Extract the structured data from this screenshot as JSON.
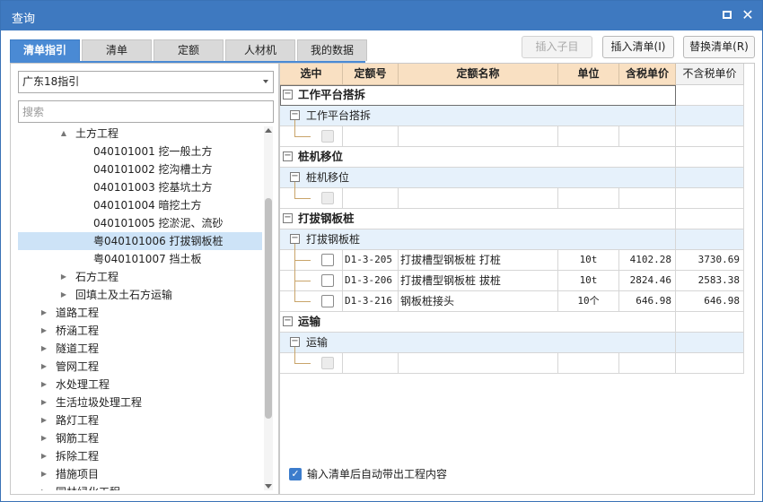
{
  "window": {
    "title": "查询"
  },
  "tabs": [
    {
      "label": "清单指引"
    },
    {
      "label": "清单"
    },
    {
      "label": "定额"
    },
    {
      "label": "人材机"
    },
    {
      "label": "我的数据"
    }
  ],
  "toolbar": {
    "insert_child": "插入子目",
    "insert_list": "插入清单(I)",
    "replace_list": "替换清单(R)"
  },
  "left": {
    "combo_value": "广东18指引",
    "search_placeholder": "搜索",
    "tree": [
      {
        "code": "",
        "name": "土方工程",
        "toggle": "▲"
      },
      {
        "code": "040101001",
        "name": "挖一般土方",
        "toggle": ""
      },
      {
        "code": "040101002",
        "name": "挖沟槽土方",
        "toggle": ""
      },
      {
        "code": "040101003",
        "name": "挖基坑土方",
        "toggle": ""
      },
      {
        "code": "040101004",
        "name": "暗挖土方",
        "toggle": ""
      },
      {
        "code": "040101005",
        "name": "挖淤泥、流砂",
        "toggle": ""
      },
      {
        "code": "粤040101006",
        "name": "打拔钢板桩",
        "toggle": ""
      },
      {
        "code": "粤040101007",
        "name": "挡土板",
        "toggle": ""
      },
      {
        "code": "",
        "name": "石方工程",
        "toggle": "▶"
      },
      {
        "code": "",
        "name": "回填土及土石方运输",
        "toggle": "▶"
      },
      {
        "code": "",
        "name": "道路工程",
        "toggle": "▶"
      },
      {
        "code": "",
        "name": "桥涵工程",
        "toggle": "▶"
      },
      {
        "code": "",
        "name": "隧道工程",
        "toggle": "▶"
      },
      {
        "code": "",
        "name": "管网工程",
        "toggle": "▶"
      },
      {
        "code": "",
        "name": "水处理工程",
        "toggle": "▶"
      },
      {
        "code": "",
        "name": "生活垃圾处理工程",
        "toggle": "▶"
      },
      {
        "code": "",
        "name": "路灯工程",
        "toggle": "▶"
      },
      {
        "code": "",
        "name": "钢筋工程",
        "toggle": "▶"
      },
      {
        "code": "",
        "name": "拆除工程",
        "toggle": "▶"
      },
      {
        "code": "",
        "name": "措施项目",
        "toggle": "▶"
      },
      {
        "code": "",
        "name": "园林绿化工程",
        "toggle": "▶"
      }
    ]
  },
  "grid": {
    "columns": [
      "选中",
      "定额号",
      "定额名称",
      "单位",
      "含税单价",
      "不含税单价"
    ],
    "groups": [
      {
        "title": "工作平台搭拆",
        "sub": "工作平台搭拆",
        "items": [
          {
            "code": "",
            "name": "",
            "unit": "",
            "price_tax": "",
            "price_notax": "",
            "disabled": true
          }
        ]
      },
      {
        "title": "桩机移位",
        "sub": "桩机移位",
        "items": [
          {
            "code": "",
            "name": "",
            "unit": "",
            "price_tax": "",
            "price_notax": "",
            "disabled": true
          }
        ]
      },
      {
        "title": "打拔钢板桩",
        "sub": "打拔钢板桩",
        "items": [
          {
            "code": "D1-3-205",
            "name": "打拔槽型钢板桩 打桩",
            "unit": "10t",
            "price_tax": "4102.28",
            "price_notax": "3730.69",
            "disabled": false
          },
          {
            "code": "D1-3-206",
            "name": "打拔槽型钢板桩 拔桩",
            "unit": "10t",
            "price_tax": "2824.46",
            "price_notax": "2583.38",
            "disabled": false
          },
          {
            "code": "D1-3-216",
            "name": "钢板桩接头",
            "unit": "10个",
            "price_tax": "646.98",
            "price_notax": "646.98",
            "disabled": false
          }
        ]
      },
      {
        "title": "运输",
        "sub": "运输",
        "items": [
          {
            "code": "",
            "name": "",
            "unit": "",
            "price_tax": "",
            "price_notax": "",
            "disabled": true
          }
        ]
      }
    ]
  },
  "footer": {
    "auto_label": "输入清单后自动带出工程内容",
    "auto_checked": true
  }
}
